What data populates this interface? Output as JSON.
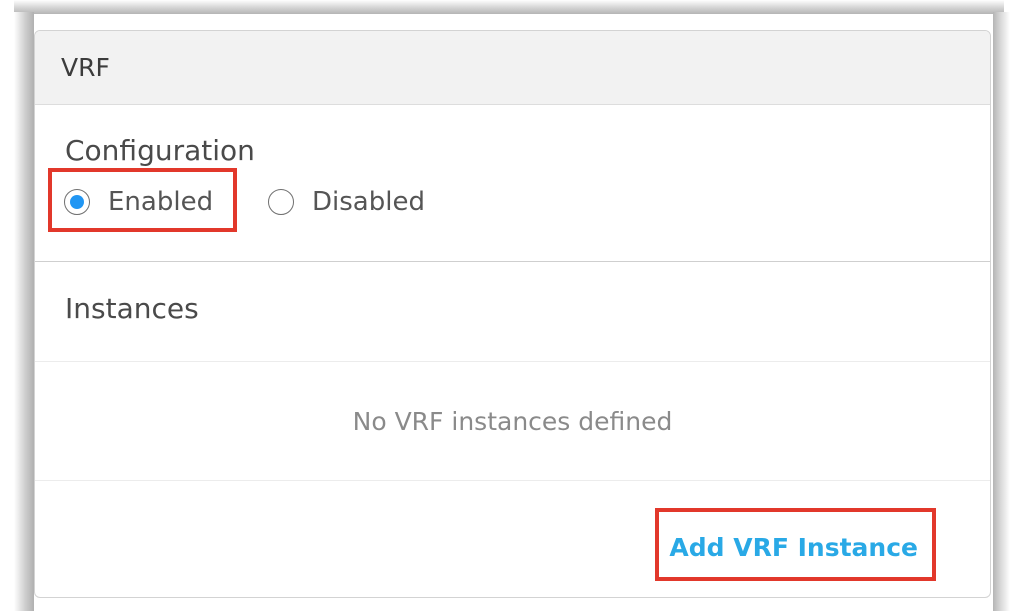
{
  "panel": {
    "title": "VRF"
  },
  "configuration": {
    "label": "Configuration",
    "options": [
      {
        "label": "Enabled",
        "selected": true
      },
      {
        "label": "Disabled",
        "selected": false
      }
    ]
  },
  "instances": {
    "label": "Instances",
    "empty_message": "No VRF instances defined",
    "add_label": "Add VRF Instance"
  },
  "colors": {
    "accent": "#29a9e6",
    "radio_selected": "#2196f3",
    "highlight": "#e2382b"
  }
}
